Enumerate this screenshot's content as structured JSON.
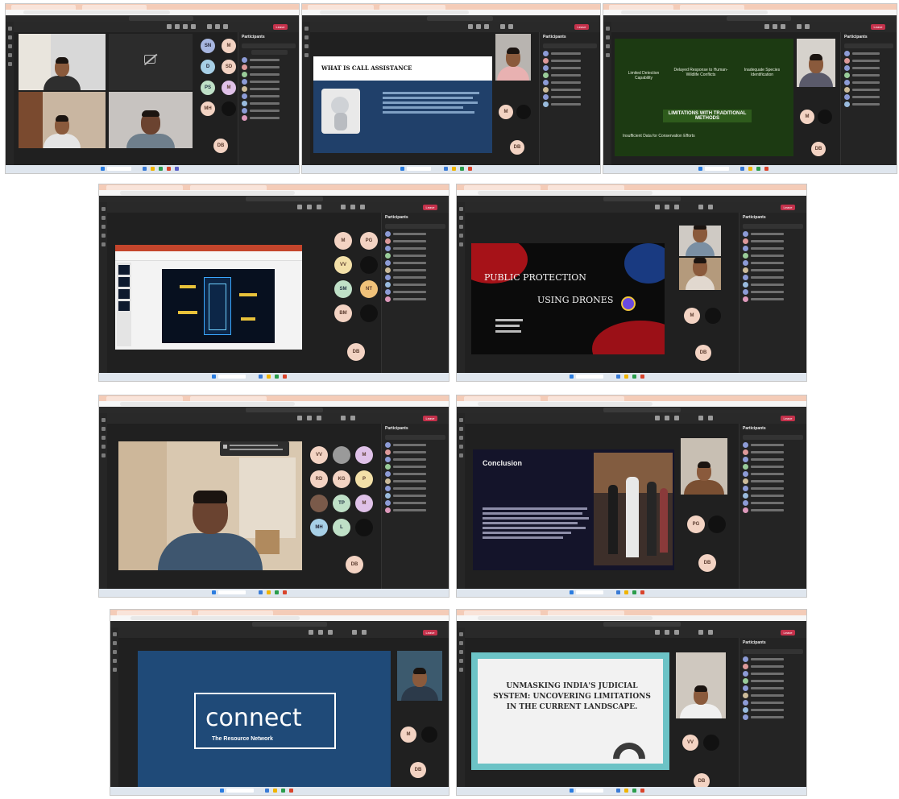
{
  "screens": [
    {
      "id": "s1",
      "participants_label": "Participants",
      "avatars": [
        "SN",
        "M",
        "D",
        "SD",
        "PS",
        "M",
        "MH",
        "DB"
      ],
      "leave_label": "Leave"
    },
    {
      "id": "s2",
      "slide_title": "WHAT IS CALL ASSISTANCE",
      "participants_label": "Participants",
      "avatars": [
        "M",
        "DB"
      ],
      "leave_label": "Leave"
    },
    {
      "id": "s3",
      "slide_headings": [
        "Limited Detection Capability",
        "Delayed Response to Human-Wildlife Conflicts",
        "Inadequate Species Identification"
      ],
      "slide_center": "LIMITATIONS WITH TRADITIONAL METHODS",
      "slide_bottom": "Insufficient Data for Conservation Efforts",
      "participants_label": "Participants",
      "avatars": [
        "M",
        "DB"
      ],
      "leave_label": "Leave"
    },
    {
      "id": "s4",
      "avatars": [
        "M",
        "PG",
        "VV",
        "SM",
        "NT",
        "BM",
        "DB"
      ],
      "participants_label": "Participants",
      "leave_label": "Leave"
    },
    {
      "id": "s5",
      "slide_title_line1": "PUBLIC PROTECTION",
      "slide_title_line2": "USING DRONES",
      "avatars": [
        "M",
        "DB"
      ],
      "participants_label": "Participants",
      "leave_label": "Leave"
    },
    {
      "id": "s6",
      "avatars": [
        "VV",
        "M",
        "RD",
        "KG",
        "P",
        "TP",
        "M",
        "MH",
        "L",
        "DB"
      ],
      "participants_label": "Participants",
      "leave_label": "Leave"
    },
    {
      "id": "s7",
      "slide_title": "Conclusion",
      "avatars": [
        "PG",
        "DB"
      ],
      "participants_label": "Participants",
      "leave_label": "Leave"
    },
    {
      "id": "s8",
      "logo_word": "connect",
      "logo_sub": "The Resource Network",
      "avatars": [
        "M",
        "DB"
      ],
      "leave_label": "Leave"
    },
    {
      "id": "s9",
      "slide_title": "UNMASKING INDIA'S JUDICIAL SYSTEM: UNCOVERING LIMITATIONS IN THE CURRENT LANDSCAPE.",
      "avatars": [
        "VV",
        "DB"
      ],
      "participants_label": "Participants",
      "leave_label": "Leave"
    }
  ],
  "colors": {
    "teams_bg": "#1f1f1f",
    "leave_red": "#c4314b",
    "browser_tab": "#f4ccb8",
    "avatar_peach": "#f3d3c3",
    "slide_navy": "#1f4a78",
    "slide_green": "#1c3a12",
    "slide_teal": "#6cc3c6"
  }
}
